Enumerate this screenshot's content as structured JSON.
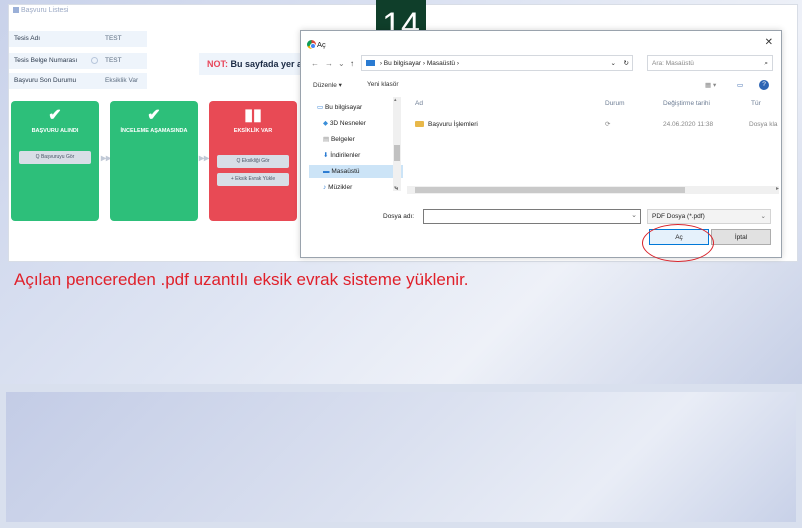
{
  "app": {
    "window_title": "Başvuru Listesi",
    "fields": [
      {
        "label": "Tesis Adı",
        "value": "TEST"
      },
      {
        "label": "Tesis Belge Numarası",
        "value": "TEST"
      },
      {
        "label": "Başvuru Son Durumu",
        "value": "Eksiklik Var"
      }
    ],
    "note_prefix": "NOT:",
    "note_text": "Bu sayfada yer al",
    "steps": [
      {
        "icon": "✔",
        "title": "BAŞVURU ALINDI",
        "buttons": [
          "Q Başvuruyu Gör"
        ],
        "color": "#2dbf7a"
      },
      {
        "icon": "✔",
        "title": "İNCELEME AŞAMASINDA",
        "buttons": [],
        "color": "#2dbf7a"
      },
      {
        "icon": "▮▮",
        "title": "EKSİKLİK VAR",
        "buttons": [
          "Q Eksikliği Gör",
          "+ Eksik Evrak Yükle"
        ],
        "color": "#e84a55"
      }
    ]
  },
  "dialog": {
    "title": "Aç",
    "close_glyph": "✕",
    "nav_back": "←",
    "nav_forward": "→",
    "nav_history": "⌄",
    "nav_up": "↑",
    "breadcrumb": [
      "Bu bilgisayar",
      "Masaüstü"
    ],
    "breadcrumb_sep": "›",
    "path_dropdown": "⌄",
    "refresh_glyph": "↻",
    "search_placeholder": "Ara: Masaüstü",
    "search_glyph": "⌕",
    "toolbar": {
      "organize": "Düzenle ▾",
      "new_folder": "Yeni klasör",
      "view": "▦ ▾",
      "pane": "▭",
      "help": "?"
    },
    "nav_items": [
      {
        "label": "Bu bilgisayar",
        "icon": "computer-icon"
      },
      {
        "label": "3D Nesneler",
        "icon": "cube-icon"
      },
      {
        "label": "Belgeler",
        "icon": "document-icon"
      },
      {
        "label": "İndirilenler",
        "icon": "download-icon"
      },
      {
        "label": "Masaüstü",
        "icon": "desktop-icon"
      },
      {
        "label": "Müzikler",
        "icon": "music-icon"
      }
    ],
    "columns": [
      "Ad",
      "Durum",
      "Değiştirme tarihi",
      "Tür"
    ],
    "files": [
      {
        "name": "Başvuru İşlemleri",
        "status": "⟳",
        "modified": "24.06.2020 11:38",
        "type": "Dosya kla"
      }
    ],
    "filename_label": "Dosya adı:",
    "filename_value": "",
    "filetype": "PDF Dosya (*.pdf)",
    "open_button": "Aç",
    "cancel_button": "İptal",
    "scroll_up": "▴",
    "scroll_down": "▾",
    "scroll_left": "◂",
    "scroll_right": "▸"
  },
  "step_badge": "14",
  "caption": "Açılan pencereden .pdf uzantılı eksik evrak sisteme yüklenir.",
  "colors": {
    "caption": "#e0202a",
    "badge_bg": "#0f3e2a",
    "highlight": "#d9222a"
  }
}
